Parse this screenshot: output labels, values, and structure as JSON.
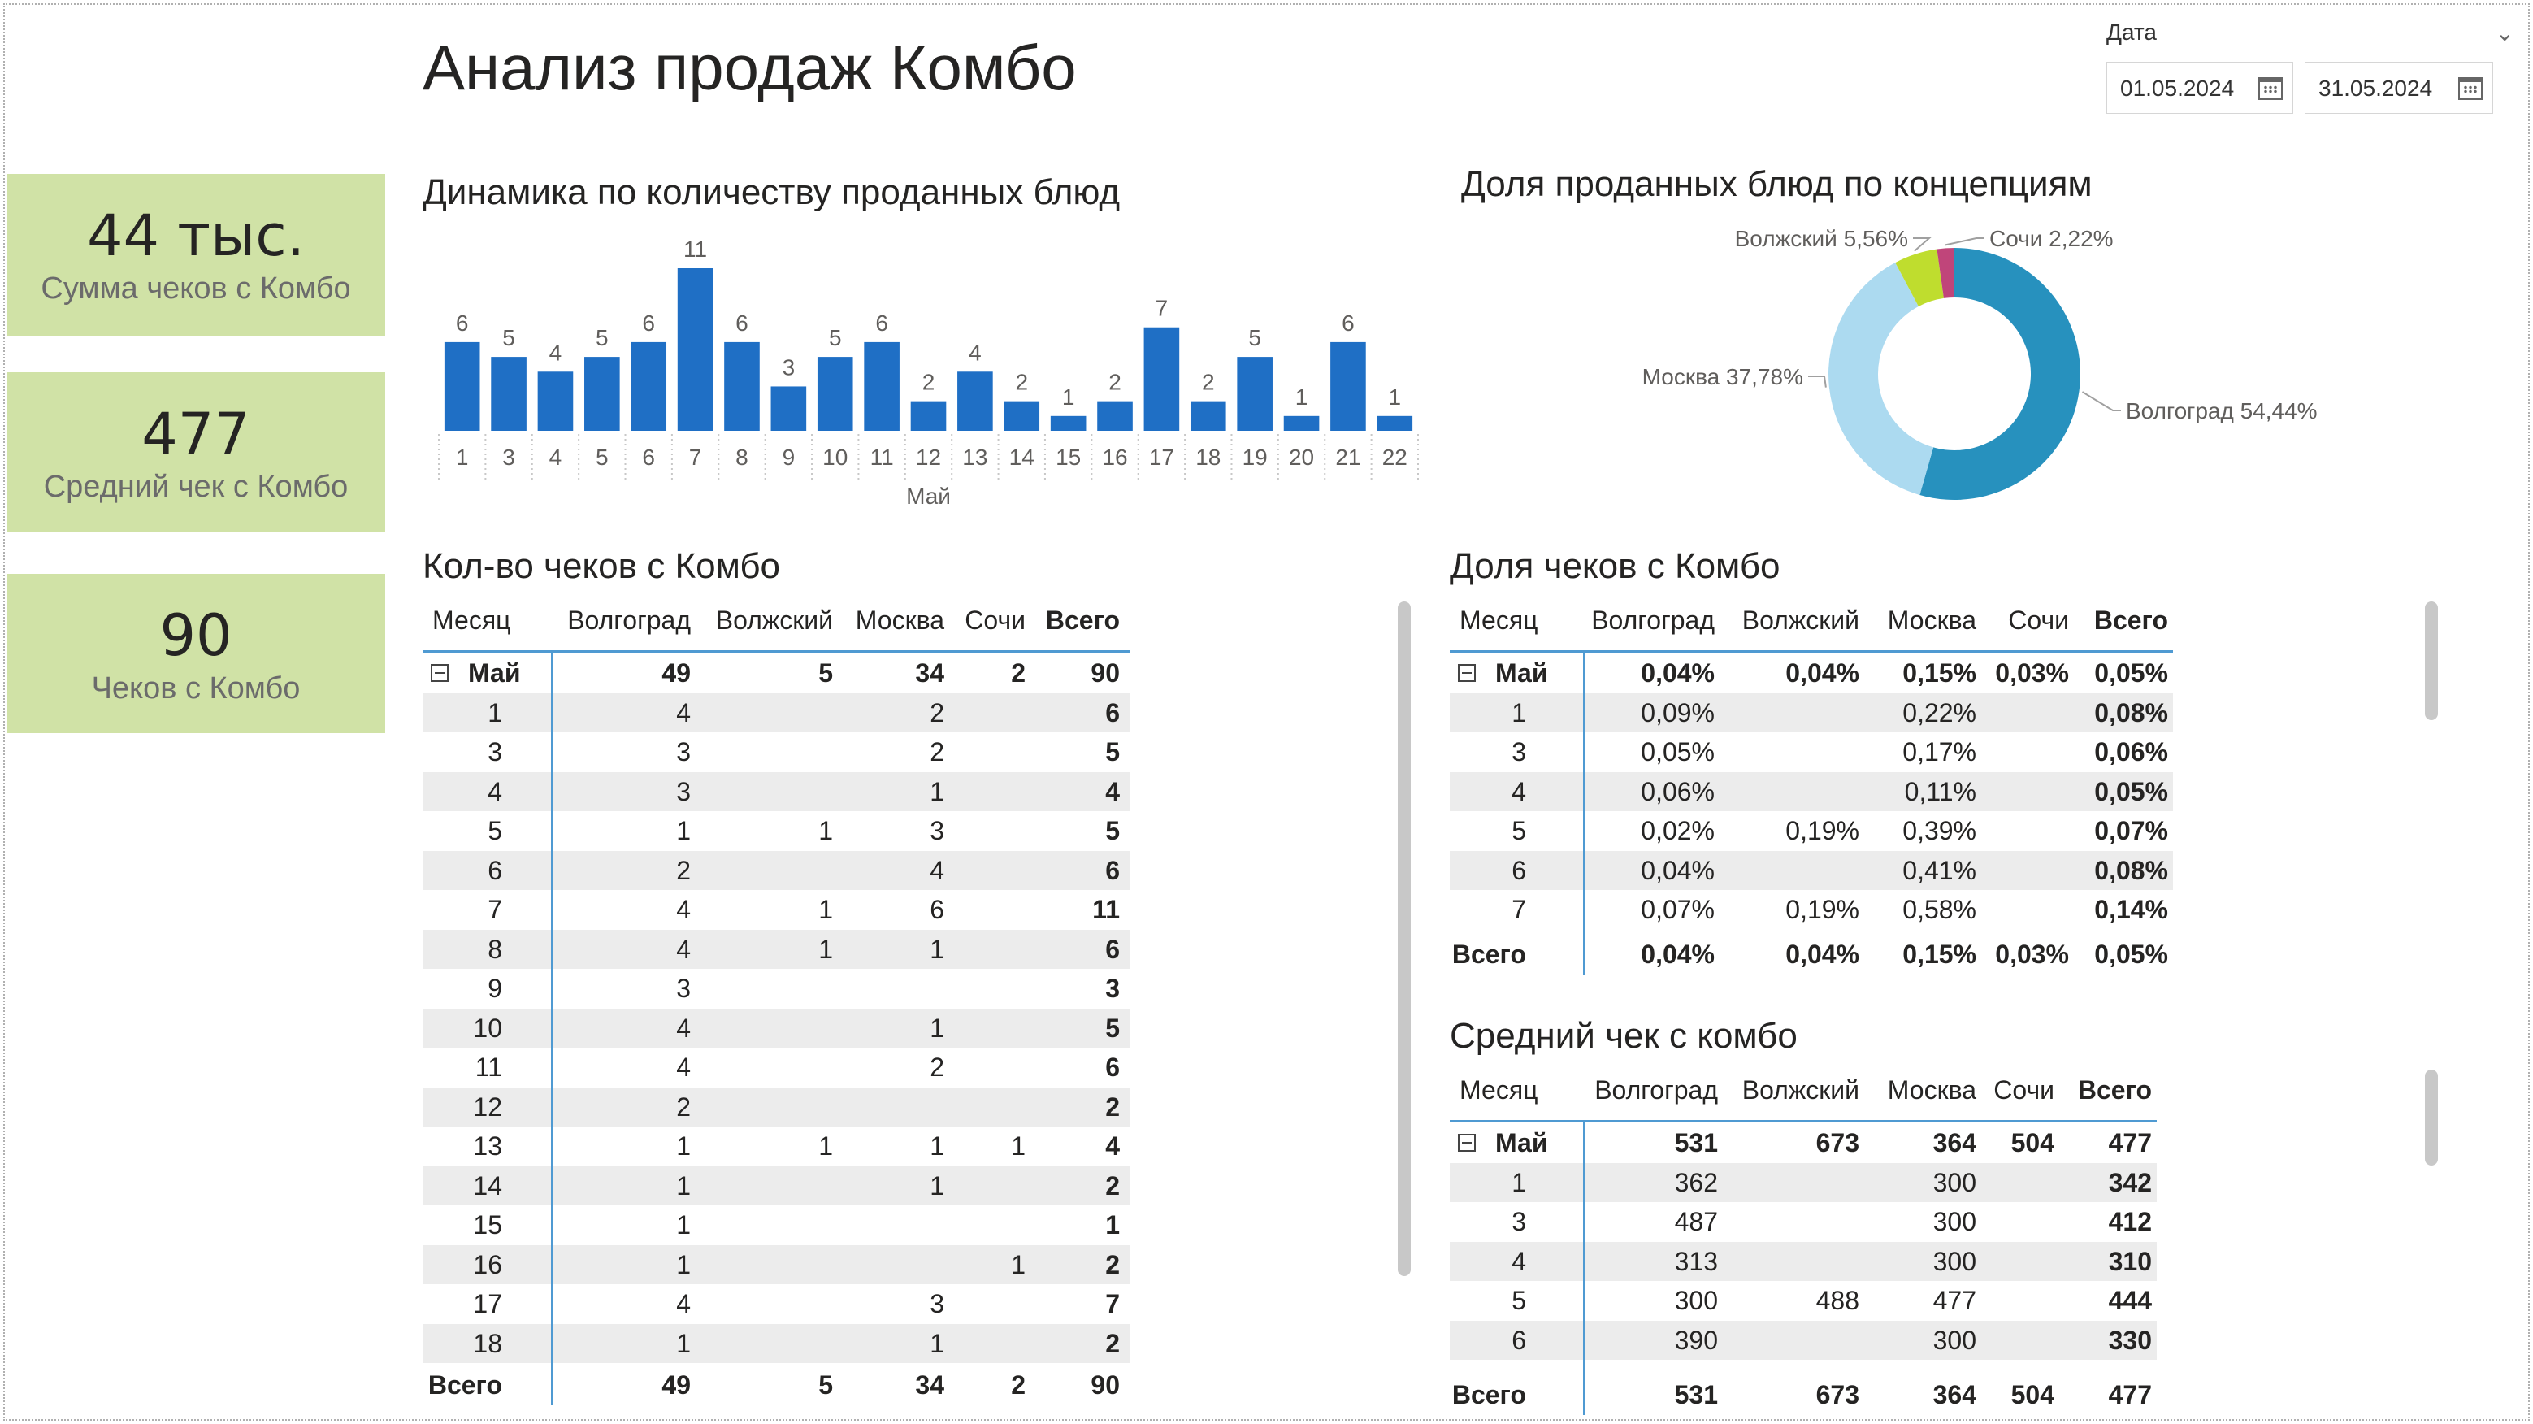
{
  "page": {
    "title": "Анализ продаж Комбо"
  },
  "slicer": {
    "label": "Дата",
    "date_from": "01.05.2024",
    "date_to": "31.05.2024"
  },
  "kpis": [
    {
      "value": "44 тыс.",
      "label": "Сумма чеков с Комбо"
    },
    {
      "value": "477",
      "label": "Средний чек с Комбо"
    },
    {
      "value": "90",
      "label": "Чеков с Комбо"
    }
  ],
  "bar_section_title": "Динамика по количеству проданных блюд",
  "donut_section_title": "Доля проданных блюд по концепциям",
  "chart_data": [
    {
      "type": "bar",
      "title": "Динамика по количеству проданных блюд",
      "xlabel": "Май",
      "categories": [
        "1",
        "3",
        "4",
        "5",
        "6",
        "7",
        "8",
        "9",
        "10",
        "11",
        "12",
        "13",
        "14",
        "15",
        "16",
        "17",
        "18",
        "19",
        "20",
        "21",
        "22"
      ],
      "values": [
        6,
        5,
        4,
        5,
        6,
        11,
        6,
        3,
        5,
        6,
        2,
        4,
        2,
        1,
        2,
        7,
        2,
        5,
        1,
        6,
        1
      ],
      "color": "#1f6fc5",
      "ylim": [
        0,
        11
      ]
    },
    {
      "type": "pie",
      "title": "Доля проданных блюд по концепциям",
      "donut": true,
      "slices": [
        {
          "label": "Волгоград",
          "value": 54.44,
          "text": "Волгоград 54,44%",
          "color": "#2791be"
        },
        {
          "label": "Москва",
          "value": 37.78,
          "text": "Москва 37,78%",
          "color": "#acdaf0"
        },
        {
          "label": "Волжский",
          "value": 5.56,
          "text": "Волжский 5,56%",
          "color": "#bfdd2e"
        },
        {
          "label": "Сочи",
          "value": 2.22,
          "text": "Сочи 2,22%",
          "color": "#c0457a"
        }
      ]
    }
  ],
  "table_count": {
    "title": "Кол-во чеков с Комбо",
    "headers": [
      "Месяц",
      "Волгоград",
      "Волжский",
      "Москва",
      "Сочи",
      "Всего"
    ],
    "group_row": [
      "Май",
      "49",
      "5",
      "34",
      "2",
      "90"
    ],
    "rows": [
      [
        "1",
        "4",
        "",
        "2",
        "",
        "6"
      ],
      [
        "3",
        "3",
        "",
        "2",
        "",
        "5"
      ],
      [
        "4",
        "3",
        "",
        "1",
        "",
        "4"
      ],
      [
        "5",
        "1",
        "1",
        "3",
        "",
        "5"
      ],
      [
        "6",
        "2",
        "",
        "4",
        "",
        "6"
      ],
      [
        "7",
        "4",
        "1",
        "6",
        "",
        "11"
      ],
      [
        "8",
        "4",
        "1",
        "1",
        "",
        "6"
      ],
      [
        "9",
        "3",
        "",
        "",
        "",
        "3"
      ],
      [
        "10",
        "4",
        "",
        "1",
        "",
        "5"
      ],
      [
        "11",
        "4",
        "",
        "2",
        "",
        "6"
      ],
      [
        "12",
        "2",
        "",
        "",
        "",
        "2"
      ],
      [
        "13",
        "1",
        "1",
        "1",
        "1",
        "4"
      ],
      [
        "14",
        "1",
        "",
        "1",
        "",
        "2"
      ],
      [
        "15",
        "1",
        "",
        "",
        "",
        "1"
      ],
      [
        "16",
        "1",
        "",
        "",
        "1",
        "2"
      ],
      [
        "17",
        "4",
        "",
        "3",
        "",
        "7"
      ],
      [
        "18",
        "1",
        "",
        "1",
        "",
        "2"
      ]
    ],
    "total_row": [
      "Всего",
      "49",
      "5",
      "34",
      "2",
      "90"
    ]
  },
  "table_share": {
    "title": "Доля чеков с Комбо",
    "headers": [
      "Месяц",
      "Волгоград",
      "Волжский",
      "Москва",
      "Сочи",
      "Всего"
    ],
    "group_row": [
      "Май",
      "0,04%",
      "0,04%",
      "0,15%",
      "0,03%",
      "0,05%"
    ],
    "rows": [
      [
        "1",
        "0,09%",
        "",
        "0,22%",
        "",
        "0,08%"
      ],
      [
        "3",
        "0,05%",
        "",
        "0,17%",
        "",
        "0,06%"
      ],
      [
        "4",
        "0,06%",
        "",
        "0,11%",
        "",
        "0,05%"
      ],
      [
        "5",
        "0,02%",
        "0,19%",
        "0,39%",
        "",
        "0,07%"
      ],
      [
        "6",
        "0,04%",
        "",
        "0,41%",
        "",
        "0,08%"
      ],
      [
        "7",
        "0,07%",
        "0,19%",
        "0,58%",
        "",
        "0,14%"
      ]
    ],
    "total_row": [
      "Всего",
      "0,04%",
      "0,04%",
      "0,15%",
      "0,03%",
      "0,05%"
    ]
  },
  "table_avg": {
    "title": "Средний чек с комбо",
    "headers": [
      "Месяц",
      "Волгоград",
      "Волжский",
      "Москва",
      "Сочи",
      "Всего"
    ],
    "group_row": [
      "Май",
      "531",
      "673",
      "364",
      "504",
      "477"
    ],
    "rows": [
      [
        "1",
        "362",
        "",
        "300",
        "",
        "342"
      ],
      [
        "3",
        "487",
        "",
        "300",
        "",
        "412"
      ],
      [
        "4",
        "313",
        "",
        "300",
        "",
        "310"
      ],
      [
        "5",
        "300",
        "488",
        "477",
        "",
        "444"
      ],
      [
        "6",
        "390",
        "",
        "300",
        "",
        "330"
      ]
    ],
    "total_row": [
      "Всего",
      "531",
      "673",
      "364",
      "504",
      "477"
    ]
  }
}
